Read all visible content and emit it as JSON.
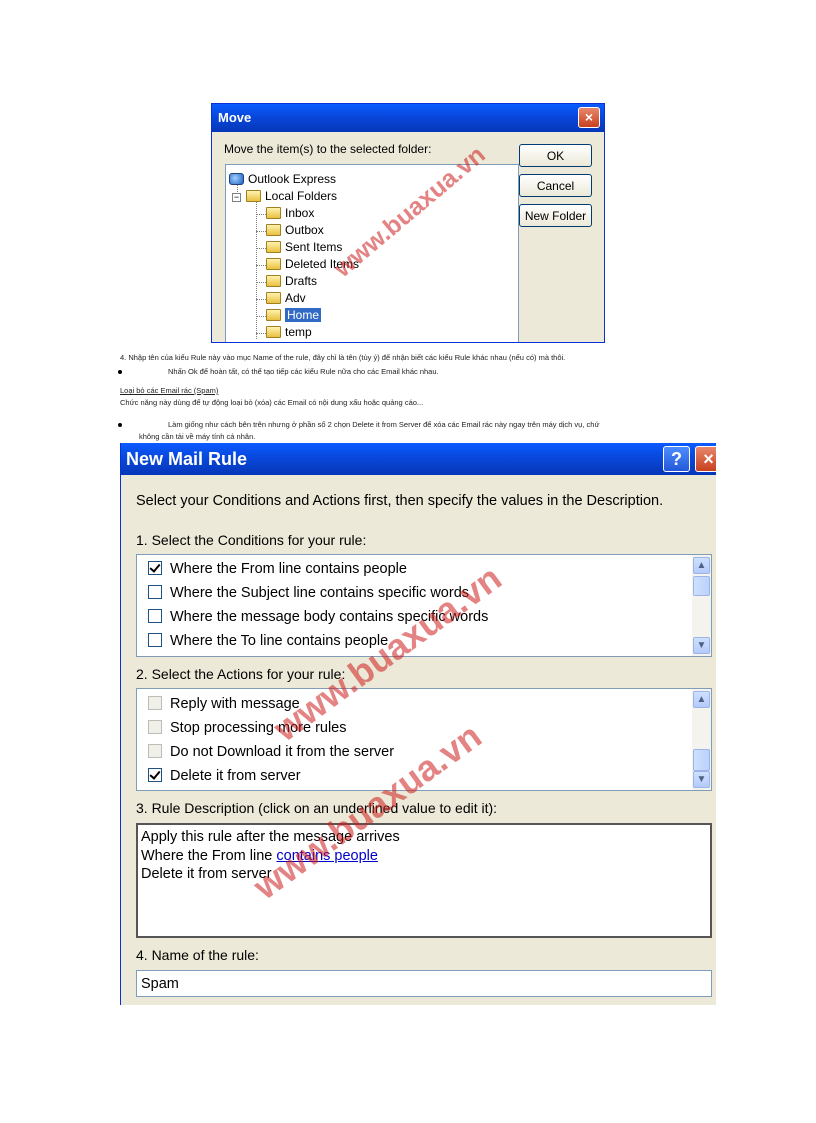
{
  "move_dialog": {
    "title": "Move",
    "close_glyph": "×",
    "prompt": "Move the item(s) to the selected folder:",
    "buttons": {
      "ok": "OK",
      "cancel": "Cancel",
      "new_folder": "New Folder"
    },
    "tree": {
      "root": "Outlook Express",
      "local": "Local Folders",
      "expander": "−",
      "folders": [
        "Inbox",
        "Outbox",
        "Sent Items",
        "Deleted Items",
        "Drafts",
        "Adv",
        "Home",
        "temp"
      ],
      "selected": "Home"
    }
  },
  "doc": {
    "step4": "4. Nhập tên của kiểu Rule này vào mục Name of the rule, đây chỉ là tên (tùy ý) để nhận biết các kiểu Rule khác nhau (nếu có) mà thôi.",
    "bullet1": "Nhấn Ok để hoàn tất, có thể tạo tiếp các kiểu Rule nữa cho các Email khác nhau.",
    "section_heading": "Loại bỏ các Email rác (Spam)",
    "section_intro": "Chức năng này dùng để tự động loại bỏ (xóa) các Email có nội dung xấu hoặc quảng cáo...",
    "bullet2_line1": "Làm giống như cách bên trên nhưng ở phần số 2 chọn Delete it from Server để xóa các Email rác này ngay trên máy dịch vụ, chứ",
    "bullet2_line2": "không cần tải về máy tính cá nhân."
  },
  "rule_dialog": {
    "title": "New Mail Rule",
    "help_glyph": "?",
    "close_glyph": "×",
    "instructions": "Select your Conditions and Actions first, then specify the values in the Description.",
    "conditions_label": "1. Select the Conditions for your rule:",
    "conditions": [
      {
        "label": "Where the From line contains people",
        "checked": true
      },
      {
        "label": "Where the Subject line contains specific words",
        "checked": false
      },
      {
        "label": "Where the message body contains specific words",
        "checked": false
      },
      {
        "label": "Where the To line contains people",
        "checked": false
      }
    ],
    "actions_label": "2. Select the Actions for your rule:",
    "actions": [
      {
        "label": "Reply with message",
        "checked": false
      },
      {
        "label": "Stop processing more rules",
        "checked": false
      },
      {
        "label": "Do not Download it from the server",
        "checked": false
      },
      {
        "label": "Delete it from server",
        "checked": true
      }
    ],
    "description_label": "3. Rule Description (click on an underlined value to edit it):",
    "description": {
      "line1": "Apply this rule after the message arrives",
      "line2_prefix": "Where the From line ",
      "line2_link": "contains people",
      "line3": "Delete it from server"
    },
    "name_label": "4. Name of the rule:",
    "name_value": "Spam"
  },
  "watermarks": {
    "top": "www.buaxua.vn",
    "middle": "www.buaxua.vn",
    "bottom": "www.buaxua.vn"
  },
  "colors": {
    "xp_title_blue": "#0a5bff",
    "dialog_face": "#ece9d8",
    "selection": "#316ac5",
    "watermark_red": "#cd1e1e",
    "link_blue": "#0000cc"
  }
}
